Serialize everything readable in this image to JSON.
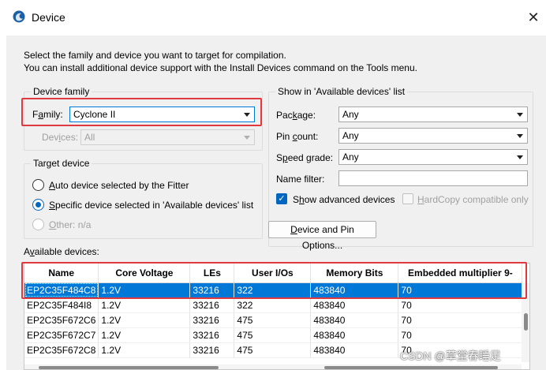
{
  "window": {
    "title": "Device",
    "close_glyph": "✕"
  },
  "intro": {
    "line1": "Select the family and device you want to target for compilation.",
    "line2": "You can install additional device support with the Install Devices command on the Tools menu."
  },
  "device_family": {
    "group_label": "Device family",
    "family_label_prefix": "F",
    "family_label_accel": "a",
    "family_label_rest": "mily:",
    "family_value": "Cyclone II",
    "devices_label_prefix": "Dev",
    "devices_label_accel": "i",
    "devices_label_rest": "ces:",
    "devices_value": "All"
  },
  "target_device": {
    "group_label": "Target device",
    "auto_prefix": "",
    "auto_accel": "A",
    "auto_rest": "uto device selected by the Fitter",
    "specific_prefix": "",
    "specific_accel": "S",
    "specific_rest": "pecific device selected in 'Available devices' list",
    "other_prefix": "",
    "other_accel": "O",
    "other_rest": "ther:  n/a"
  },
  "show_in_list": {
    "group_label": "Show in 'Available devices' list",
    "package_label_prefix": "Pac",
    "package_label_accel": "k",
    "package_label_rest": "age:",
    "package_value": "Any",
    "pin_count_label_prefix": "Pin ",
    "pin_count_label_accel": "c",
    "pin_count_label_rest": "ount:",
    "pin_count_value": "Any",
    "speed_label_prefix": "S",
    "speed_label_accel": "p",
    "speed_label_rest": "eed grade:",
    "speed_value": "Any",
    "name_filter_label": "Name filter:",
    "name_filter_value": "",
    "show_adv_prefix": "S",
    "show_adv_accel": "h",
    "show_adv_rest": "ow advanced devices",
    "hardcopy_prefix": "",
    "hardcopy_accel": "H",
    "hardcopy_rest": "ardCopy compatible only"
  },
  "options_button": {
    "prefix": "",
    "accel": "D",
    "rest": "evice and Pin Options..."
  },
  "available_devices": {
    "label_prefix": "A",
    "label_accel": "v",
    "label_rest": "ailable devices:",
    "columns": [
      "Name",
      "Core Voltage",
      "LEs",
      "User I/Os",
      "Memory Bits",
      "Embedded multiplier 9-"
    ],
    "rows": [
      [
        "EP2C35F484C8",
        "1.2V",
        "33216",
        "322",
        "483840",
        "70"
      ],
      [
        "EP2C35F484I8",
        "1.2V",
        "33216",
        "322",
        "483840",
        "70"
      ],
      [
        "EP2C35F672C6",
        "1.2V",
        "33216",
        "475",
        "483840",
        "70"
      ],
      [
        "EP2C35F672C7",
        "1.2V",
        "33216",
        "475",
        "483840",
        "70"
      ],
      [
        "EP2C35F672C8",
        "1.2V",
        "33216",
        "475",
        "483840",
        "70"
      ]
    ],
    "selected_row": 0
  },
  "watermark": "CSDN @草堂春睡足",
  "colors": {
    "highlight": "#e0393f",
    "selection": "#0078d7",
    "dialog_bg": "#f0f0f0"
  }
}
